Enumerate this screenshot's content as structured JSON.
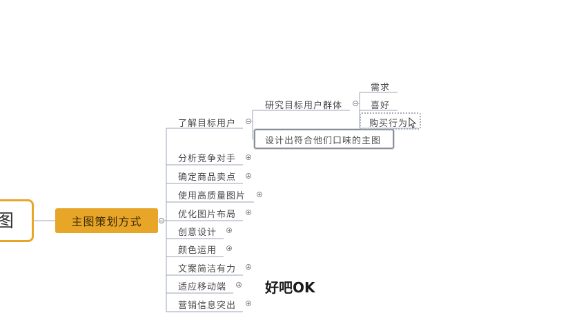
{
  "mindmap": {
    "root_label": "图",
    "main_topic": "主图策划方式",
    "branches": [
      {
        "label": "了解目标用户",
        "toggle": "collapse"
      },
      {
        "label": "分析竞争对手",
        "toggle": "expand"
      },
      {
        "label": "确定商品卖点",
        "toggle": "expand"
      },
      {
        "label": "使用高质量图片",
        "toggle": "expand"
      },
      {
        "label": "优化图片布局",
        "toggle": "expand"
      },
      {
        "label": "创意设计",
        "toggle": "expand"
      },
      {
        "label": "颜色运用",
        "toggle": "expand"
      },
      {
        "label": "文案简洁有力",
        "toggle": "expand"
      },
      {
        "label": "适应移动端",
        "toggle": "expand"
      },
      {
        "label": "营销信息突出",
        "toggle": "expand"
      }
    ],
    "user_subtopics": {
      "research": "研究目标用户群体",
      "design": "设计出符合他们口味的主图"
    },
    "research_children": [
      "需求",
      "喜好",
      "购买行为"
    ],
    "annotation": "好吧OK"
  },
  "colors": {
    "accent": "#e8a628",
    "line": "#9aa3b4",
    "text": "#4a4a4a"
  }
}
